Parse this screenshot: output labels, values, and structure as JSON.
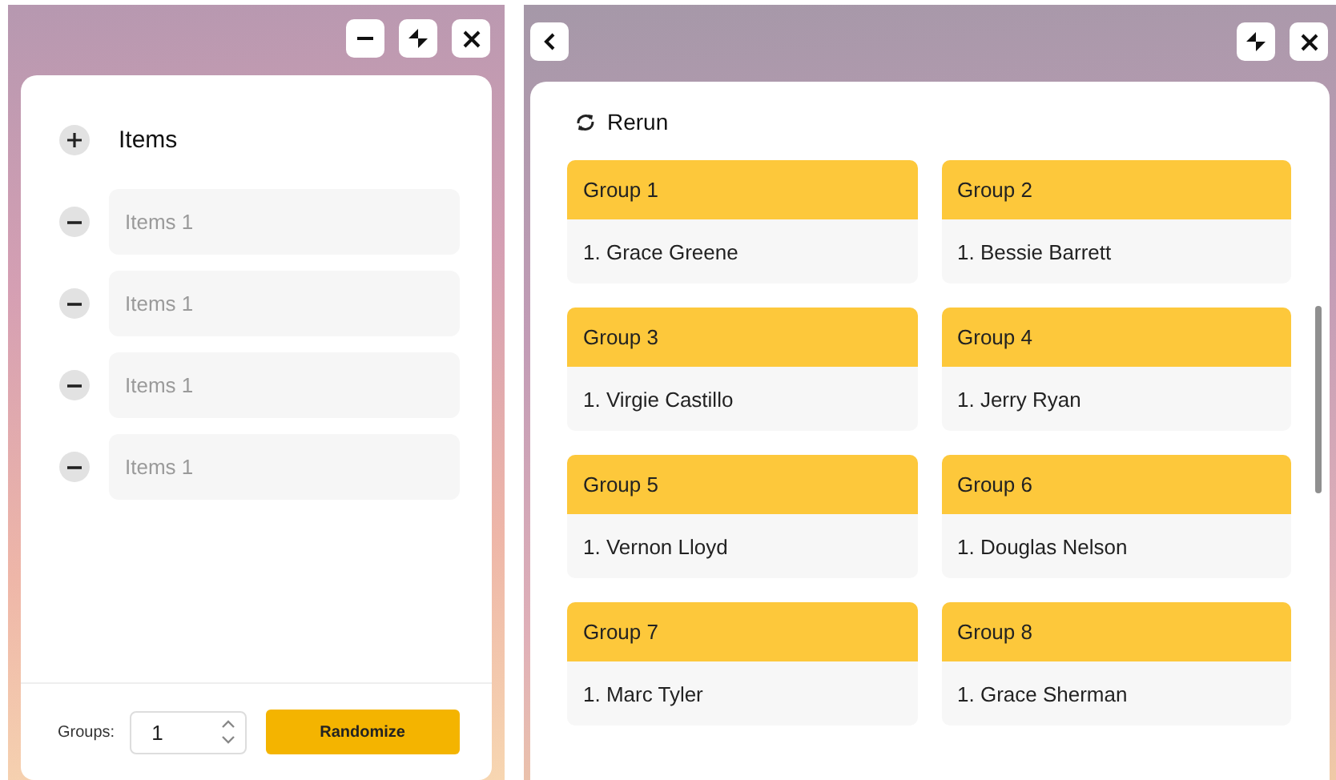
{
  "left": {
    "header": {
      "label": "Items"
    },
    "items": [
      {
        "placeholder": "Items 1"
      },
      {
        "placeholder": "Items 1"
      },
      {
        "placeholder": "Items 1"
      },
      {
        "placeholder": "Items 1"
      }
    ],
    "footer": {
      "groups_label": "Groups:",
      "groups_value": "1",
      "button": "Randomize"
    }
  },
  "right": {
    "rerun": "Rerun",
    "groups": [
      {
        "title": "Group 1",
        "members": [
          "1. Grace Greene"
        ]
      },
      {
        "title": "Group 2",
        "members": [
          "1. Bessie Barrett"
        ]
      },
      {
        "title": "Group 3",
        "members": [
          "1. Virgie Castillo"
        ]
      },
      {
        "title": "Group 4",
        "members": [
          "1. Jerry Ryan"
        ]
      },
      {
        "title": "Group 5",
        "members": [
          "1. Vernon Lloyd"
        ]
      },
      {
        "title": "Group 6",
        "members": [
          "1. Douglas Nelson"
        ]
      },
      {
        "title": "Group 7",
        "members": [
          "1. Marc Tyler"
        ]
      },
      {
        "title": "Group 8",
        "members": [
          "1. Grace Sherman"
        ]
      }
    ]
  }
}
